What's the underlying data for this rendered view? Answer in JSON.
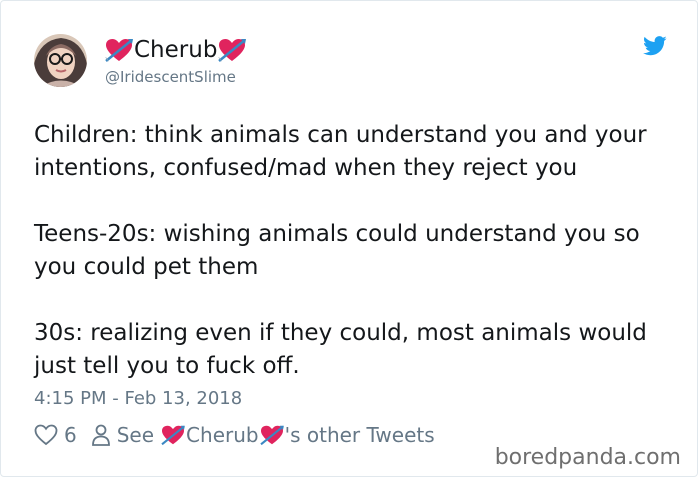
{
  "tweet": {
    "display_name": "Cherub",
    "handle": "@IridescentSlime",
    "paragraphs": [
      "Children: think animals can understand you and your intentions, confused/mad when they reject you",
      "Teens-20s: wishing animals could understand you so you could pet them",
      "30s: realizing even if they could, most animals would just tell you to fuck off."
    ],
    "timestamp": "4:15 PM - Feb 13, 2018",
    "likes": "6",
    "see_prefix": "See",
    "see_suffix": "'s other Tweets"
  },
  "icons": {
    "name_decoration": "heart-with-arrow-icon",
    "platform": "twitter-bird-icon",
    "like": "heart-outline-icon",
    "profile": "person-outline-icon"
  },
  "colors": {
    "twitter_blue": "#1da1f2",
    "heart_pink": "#e0245e",
    "muted_text": "#657786"
  },
  "watermark": "boredpanda.com"
}
